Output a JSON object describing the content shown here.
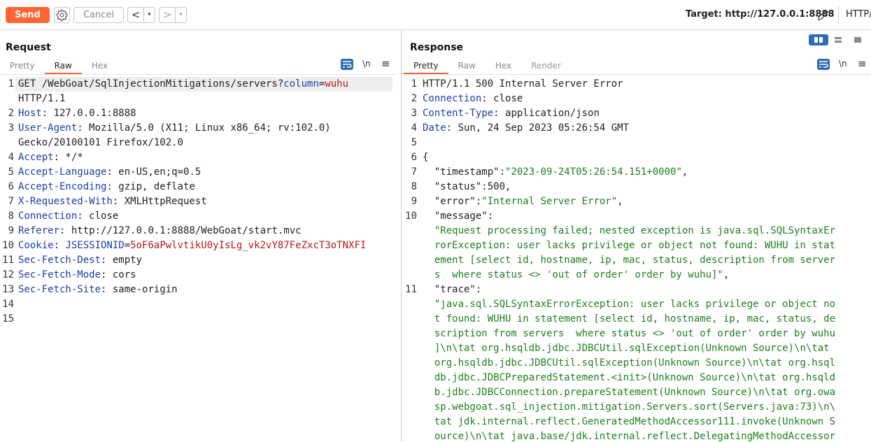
{
  "toolbar": {
    "send_label": "Send",
    "cancel_label": "Cancel",
    "back_label": "<",
    "forward_label": ">",
    "caret": "▾",
    "target_label": "Target: http://127.0.0.1:8888",
    "http_label": "HTTP/"
  },
  "request": {
    "title": "Request",
    "tabs": [
      "Pretty",
      "Raw",
      "Hex"
    ],
    "active_tab": "Raw",
    "newline_icon": "\\n",
    "menu_icon": "≡",
    "lines": [
      {
        "n": "1",
        "pre": "GET /WebGoat/SqlInjectionMitigations/servers?",
        "param": "column",
        "eq": "=",
        "pval": "wuhu"
      },
      {
        "n": "",
        "text": "HTTP/1.1"
      },
      {
        "n": "2",
        "key": "Host",
        "val": ": 127.0.0.1:8888"
      },
      {
        "n": "3",
        "key": "User-Agent",
        "val": ": Mozilla/5.0 (X11; Linux x86_64; rv:102.0)"
      },
      {
        "n": "",
        "text": "Gecko/20100101 Firefox/102.0"
      },
      {
        "n": "4",
        "key": "Accept",
        "val": ": */*"
      },
      {
        "n": "5",
        "key": "Accept-Language",
        "val": ": en-US,en;q=0.5"
      },
      {
        "n": "6",
        "key": "Accept-Encoding",
        "val": ": gzip, deflate"
      },
      {
        "n": "7",
        "key": "X-Requested-With",
        "val": ": XMLHttpRequest"
      },
      {
        "n": "8",
        "key": "Connection",
        "val": ": close"
      },
      {
        "n": "9",
        "key": "Referer",
        "val": ": http://127.0.0.1:8888/WebGoat/start.mvc"
      },
      {
        "n": "10",
        "key": "Cookie",
        "val": ": ",
        "ckey": "JSESSIONID",
        "ceq": "=",
        "cval": "5oF6aPwlvtikU0yIsLg_vk2vY87FeZxcT3oTNXFI"
      },
      {
        "n": "11",
        "key": "Sec-Fetch-Dest",
        "val": ": empty"
      },
      {
        "n": "12",
        "key": "Sec-Fetch-Mode",
        "val": ": cors"
      },
      {
        "n": "13",
        "key": "Sec-Fetch-Site",
        "val": ": same-origin"
      },
      {
        "n": "14",
        "text": ""
      },
      {
        "n": "15",
        "text": ""
      }
    ]
  },
  "response": {
    "title": "Response",
    "tabs": [
      "Pretty",
      "Raw",
      "Hex",
      "Render"
    ],
    "active_tab": "Pretty",
    "newline_icon": "\\n",
    "menu_icon": "≡",
    "lines": [
      {
        "n": "1",
        "text": "HTTP/1.1 500 Internal Server Error"
      },
      {
        "n": "2",
        "key": "Connection",
        "val": ": close"
      },
      {
        "n": "3",
        "key": "Content-Type",
        "val": ": application/json"
      },
      {
        "n": "4",
        "key": "Date",
        "val": ": Sun, 24 Sep 2023 05:26:54 GMT"
      },
      {
        "n": "5",
        "text": ""
      },
      {
        "n": "6",
        "text": "{"
      },
      {
        "n": "7",
        "jkey": "  \"timestamp\":",
        "jstr": "\"2023-09-24T05:26:54.151+0000\"",
        "tail": ","
      },
      {
        "n": "8",
        "jkey": "  \"status\":",
        "jnum": "500",
        "tail": ","
      },
      {
        "n": "9",
        "jkey": "  \"error\":",
        "jstr": "\"Internal Server Error\"",
        "tail": ","
      },
      {
        "n": "10",
        "jkey": "  \"message\":"
      },
      {
        "n": "",
        "jstr": "  \"Request processing failed; nested exception is java.sql.SQLSyntaxEr"
      },
      {
        "n": "",
        "jstr": "  rorException: user lacks privilege or object not found: WUHU in stat"
      },
      {
        "n": "",
        "jstr": "  ement [select id, hostname, ip, mac, status, description from server"
      },
      {
        "n": "",
        "jstr": "  s  where status <> 'out of order' order by wuhu]\"",
        "tail": ","
      },
      {
        "n": "11",
        "jkey": "  \"trace\":"
      },
      {
        "n": "",
        "jstr": "  \"java.sql.SQLSyntaxErrorException: user lacks privilege or object no"
      },
      {
        "n": "",
        "jstr": "  t found: WUHU in statement [select id, hostname, ip, mac, status, de"
      },
      {
        "n": "",
        "jstr": "  scription from servers  where status <> 'out of order' order by wuhu"
      },
      {
        "n": "",
        "jstr": "  ]\\n\\tat org.hsqldb.jdbc.JDBCUtil.sqlException(Unknown Source)\\n\\tat"
      },
      {
        "n": "",
        "jstr": "  org.hsqldb.jdbc.JDBCUtil.sqlException(Unknown Source)\\n\\tat org.hsql"
      },
      {
        "n": "",
        "jstr": "  db.jdbc.JDBCPreparedStatement.<init>(Unknown Source)\\n\\tat org.hsqld"
      },
      {
        "n": "",
        "jstr": "  b.jdbc.JDBCConnection.prepareStatement(Unknown Source)\\n\\tat org.owa"
      },
      {
        "n": "",
        "jstr": "  sp.webgoat.sql_injection.mitigation.Servers.sort(Servers.java:73)\\n\\"
      },
      {
        "n": "",
        "jstr": "  tat jdk.internal.reflect.GeneratedMethodAccessor111.invoke(Unknown S"
      },
      {
        "n": "",
        "jstr": "  ource)\\n\\tat java.base/jdk.internal.reflect.DelegatingMethodAccessor"
      }
    ]
  },
  "colors": {
    "accent": "#ff6633",
    "toggle_blue": "#2d6db3",
    "header_key": "#1a3fa8",
    "param_value": "#b21b1b",
    "json_string": "#208020"
  },
  "icons": {
    "settings": "gear-icon",
    "edit_target": "pencil-icon",
    "wrap": "text-wrap-icon",
    "newline": "newline-icon",
    "menu": "hamburger-menu-icon"
  }
}
